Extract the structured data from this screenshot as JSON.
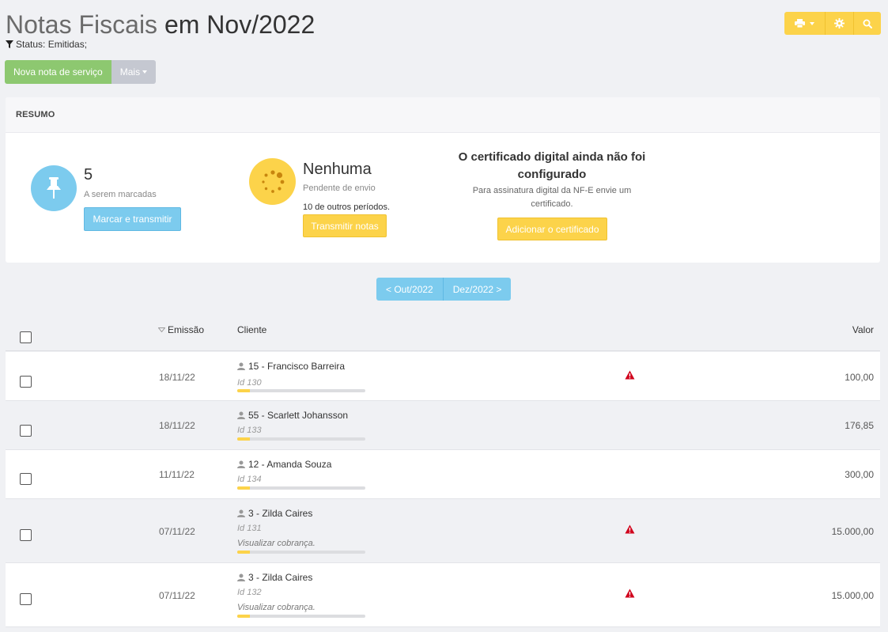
{
  "header": {
    "title_part1": "Notas Fiscais",
    "title_part2": "em Nov/2022",
    "status": "Status: Emitidas;"
  },
  "toolbar": {
    "print_icon": "printer-icon",
    "settings_icon": "gear-icon",
    "search_icon": "search-icon",
    "accent": "#fcd34a"
  },
  "actions": {
    "new_label": "Nova nota de serviço",
    "more_label": "Mais"
  },
  "summary": {
    "heading": "RESUMO",
    "marked": {
      "count": "5",
      "label": "A serem marcadas",
      "button": "Marcar e transmitir"
    },
    "pending": {
      "value": "Nenhuma",
      "label": "Pendente de envio",
      "other": "10 de outros períodos.",
      "button": "Transmitir notas"
    },
    "certificate": {
      "title": "O certificado digital ainda não foi configurado",
      "description": "Para assinatura digital da NF-E envie um certificado.",
      "button": "Adicionar o certificado"
    }
  },
  "pager": {
    "prev": "< Out/2022",
    "next": "Dez/2022 >"
  },
  "table": {
    "col_emissao": "Emissão",
    "col_cliente": "Cliente",
    "col_valor": "Valor",
    "rows": [
      {
        "date": "18/11/22",
        "client": "15 - Francisco Barreira",
        "id": "Id 130",
        "link": "",
        "warning": true,
        "value": "100,00",
        "progress": 0.1
      },
      {
        "date": "18/11/22",
        "client": "55 - Scarlett Johansson",
        "id": "Id 133",
        "link": "",
        "warning": false,
        "value": "176,85",
        "progress": 0.1
      },
      {
        "date": "11/11/22",
        "client": "12 - Amanda Souza",
        "id": "Id 134",
        "link": "",
        "warning": false,
        "value": "300,00",
        "progress": 0.1
      },
      {
        "date": "07/11/22",
        "client": "3 - Zilda Caires",
        "id": "Id 131",
        "link": "Visualizar cobrança.",
        "warning": true,
        "value": "15.000,00",
        "progress": 0.1
      },
      {
        "date": "07/11/22",
        "client": "3 - Zilda Caires",
        "id": "Id 132",
        "link": "Visualizar cobrança.",
        "warning": true,
        "value": "15.000,00",
        "progress": 0.1
      }
    ]
  }
}
